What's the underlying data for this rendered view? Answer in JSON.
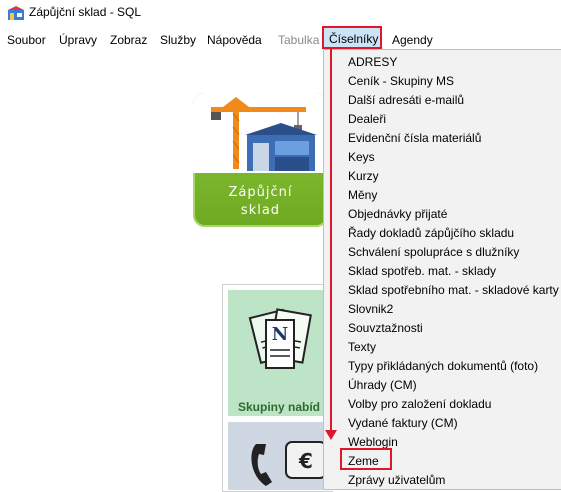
{
  "window": {
    "title": "Zápůjční sklad - SQL",
    "icon": "app-icon"
  },
  "menubar": {
    "items": [
      {
        "label": "Soubor"
      },
      {
        "label": "Úpravy"
      },
      {
        "label": "Zobraz"
      },
      {
        "label": "Služby"
      },
      {
        "label": "Nápověda"
      },
      {
        "label": "Tabulka",
        "disabled": true
      },
      {
        "label": "Číselníky",
        "active": true
      },
      {
        "label": "Agendy"
      }
    ]
  },
  "logo": {
    "line1": "Zápůjční",
    "line2": "sklad"
  },
  "tiles": [
    {
      "label": "Skupiny nabíd",
      "icon": "documents-icon"
    },
    {
      "label": "",
      "icon": "phone-euro-icon"
    }
  ],
  "dropdown": {
    "items": [
      "ADRESY",
      "Ceník - Skupiny MS",
      "Další adresáti e-mailů",
      "Dealeři",
      "Evidenční čísla materiálů",
      "Keys",
      "Kurzy",
      "Měny",
      "Objednávky přijaté",
      "Řady dokladů zápůjčího skladu",
      "Schválení spolupráce s dlužníky",
      "Sklad spotřeb. mat. - sklady",
      "Sklad spotřebního mat. - skladové karty",
      "Slovnik2",
      "Souvztažnosti",
      "Texty",
      "Typy přikládaných dokumentů (foto)",
      "Úhrady (CM)",
      "Volby pro založení dokladu",
      "Vydané faktury (CM)",
      "Weblogin",
      "Zeme",
      "Zprávy uživatelům"
    ],
    "highlighted": "Zeme"
  },
  "colors": {
    "highlight_border": "#e0162b",
    "menu_active_bg": "#cce4f7",
    "logo_green": "#7bb82c"
  }
}
